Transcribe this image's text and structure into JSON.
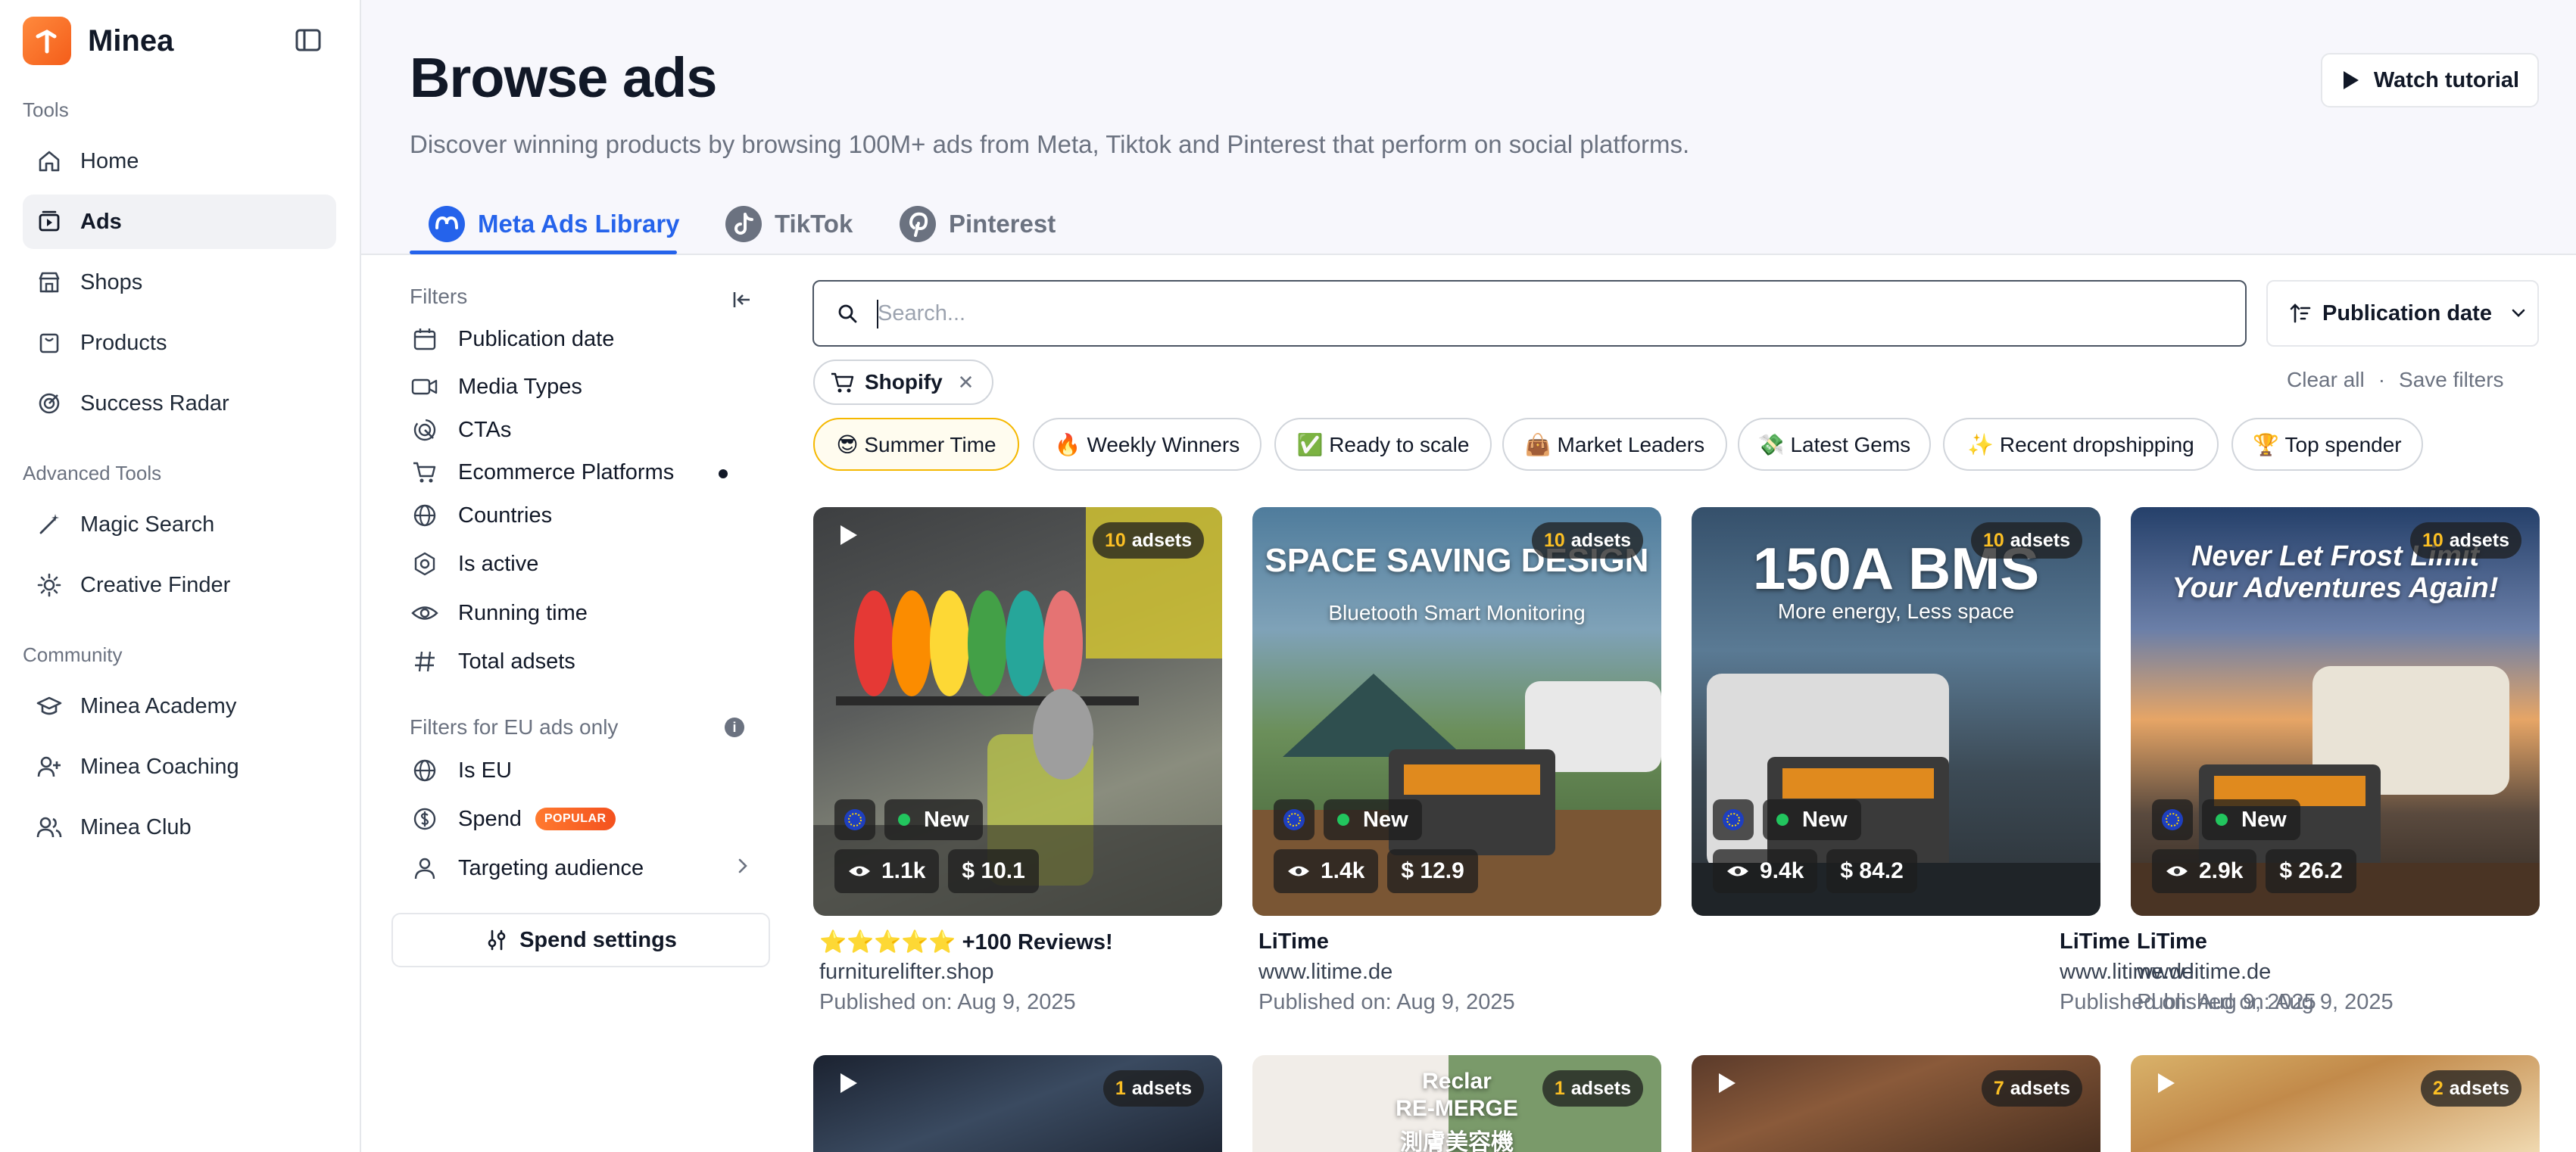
{
  "app": {
    "name": "Minea"
  },
  "sidebar": {
    "sections": [
      {
        "title": "Tools",
        "items": [
          {
            "label": "Home",
            "icon": "home-icon"
          },
          {
            "label": "Ads",
            "icon": "ads-icon",
            "active": true
          },
          {
            "label": "Shops",
            "icon": "shop-icon"
          },
          {
            "label": "Products",
            "icon": "products-icon"
          },
          {
            "label": "Success Radar",
            "icon": "radar-icon"
          }
        ]
      },
      {
        "title": "Advanced Tools",
        "items": [
          {
            "label": "Magic Search",
            "icon": "magic-wand-icon"
          },
          {
            "label": "Creative Finder",
            "icon": "sun-icon"
          }
        ]
      },
      {
        "title": "Community",
        "items": [
          {
            "label": "Minea Academy",
            "icon": "graduation-cap-icon"
          },
          {
            "label": "Minea Coaching",
            "icon": "user-plus-icon"
          },
          {
            "label": "Minea Club",
            "icon": "users-icon"
          }
        ]
      }
    ]
  },
  "header": {
    "title": "Browse ads",
    "subtitle": "Discover winning products by browsing 100M+ ads from Meta, Tiktok and Pinterest that perform on social platforms.",
    "watch_tutorial": "Watch tutorial"
  },
  "tabs": [
    {
      "label": "Meta Ads Library",
      "active": true
    },
    {
      "label": "TikTok"
    },
    {
      "label": "Pinterest"
    }
  ],
  "filters": {
    "title": "Filters",
    "items": [
      {
        "label": "Publication date",
        "icon": "calendar-icon"
      },
      {
        "label": "Media Types",
        "icon": "video-icon"
      },
      {
        "label": "CTAs",
        "icon": "cursor-click-icon"
      },
      {
        "label": "Ecommerce Platforms",
        "icon": "cart-icon",
        "has_selection": true
      },
      {
        "label": "Countries",
        "icon": "globe-icon"
      },
      {
        "label": "Is active",
        "icon": "status-icon"
      },
      {
        "label": "Running time",
        "icon": "eye-icon"
      },
      {
        "label": "Total adsets",
        "icon": "hash-icon"
      }
    ],
    "eu_title": "Filters for EU ads only",
    "eu_items": [
      {
        "label": "Is EU",
        "icon": "globe-icon"
      },
      {
        "label": "Spend",
        "icon": "dollar-icon",
        "badge": "POPULAR"
      },
      {
        "label": "Targeting audience",
        "icon": "user-icon"
      }
    ],
    "spend_settings": "Spend settings"
  },
  "search": {
    "placeholder": "Search...",
    "value": ""
  },
  "sort": {
    "label": "Publication date"
  },
  "active_chip": {
    "label": "Shopify"
  },
  "actions": {
    "clear_all": "Clear all",
    "separator": "·",
    "save_filters": "Save filters"
  },
  "presets": [
    {
      "label": "😎 Summer Time",
      "active": true
    },
    {
      "label": "🔥 Weekly Winners"
    },
    {
      "label": "✅ Ready to scale"
    },
    {
      "label": "👜 Market Leaders"
    },
    {
      "label": "💸 Latest Gems"
    },
    {
      "label": "✨ Recent dropshipping"
    },
    {
      "label": "🏆 Top spender"
    }
  ],
  "cards": [
    {
      "adsets_count": "10",
      "adsets_label": "adsets",
      "views": "1.1k",
      "spend": "$ 10.1",
      "new_label": "New",
      "title": "⭐⭐⭐⭐⭐ +100 Reviews!",
      "domain": "furniturelifter.shop",
      "published": "Published on: Aug 9, 2025"
    },
    {
      "adsets_count": "10",
      "adsets_label": "adsets",
      "views": "1.4k",
      "spend": "$ 12.9",
      "new_label": "New",
      "title": "LiTime",
      "domain": "www.litime.de",
      "published": "Published on: Aug 9, 2025",
      "thumb_line1": "SPACE SAVING DESIGN",
      "thumb_line2": "Bluetooth Smart Monitoring"
    },
    {
      "adsets_count": "10",
      "adsets_label": "adsets",
      "views": "9.4k",
      "spend": "$ 84.2",
      "new_label": "New",
      "title": "LiTime",
      "domain": "www.litime.de",
      "published": "Published on: Aug 9, 2025",
      "thumb_line1": "150A BMS",
      "thumb_line2": "More energy, Less space"
    },
    {
      "adsets_count": "10",
      "adsets_label": "adsets",
      "views": "2.9k",
      "spend": "$ 26.2",
      "new_label": "New",
      "title": "LiTime",
      "domain": "www.litime.de",
      "published": "Published on: Aug 9, 2025",
      "thumb_line1": "Never Let Frost Limit",
      "thumb_line2": "Your Adventures Again!"
    },
    {
      "adsets_count": "1",
      "adsets_label": "adsets"
    },
    {
      "adsets_count": "1",
      "adsets_label": "adsets",
      "thumb_line1": "Reclar",
      "thumb_line2": "RE-MERGE",
      "thumb_line3": "測膚美容機"
    },
    {
      "adsets_count": "7",
      "adsets_label": "adsets"
    },
    {
      "adsets_count": "2",
      "adsets_label": "adsets"
    }
  ],
  "colors": {
    "accent": "#2563eb",
    "brand": "#f45d1a",
    "new_dot": "#22c55e",
    "adset_count": "#fbbf24"
  }
}
